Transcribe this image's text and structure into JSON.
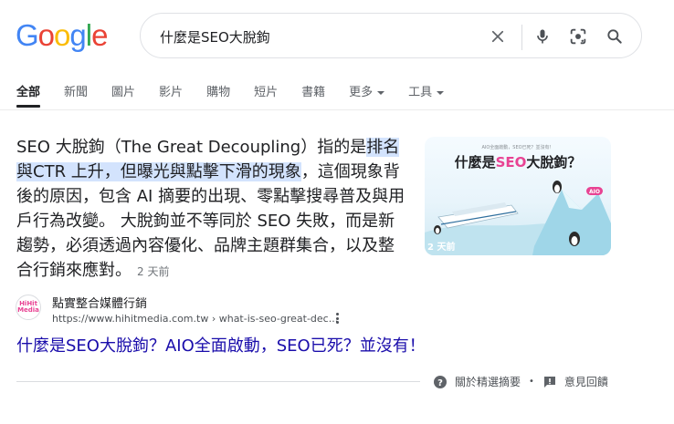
{
  "logo": {
    "letters": [
      "G",
      "o",
      "o",
      "g",
      "l",
      "e"
    ],
    "colors": [
      "#4285F4",
      "#EA4335",
      "#FBBC05",
      "#4285F4",
      "#34A853",
      "#EA4335"
    ]
  },
  "search": {
    "query": "什麼是SEO大脫鉤",
    "clear_icon": "close-icon",
    "voice_icon": "microphone-icon",
    "lens_icon": "camera-lens-icon",
    "search_icon": "search-icon"
  },
  "tabs": [
    {
      "label": "全部",
      "active": true
    },
    {
      "label": "新聞"
    },
    {
      "label": "圖片"
    },
    {
      "label": "影片"
    },
    {
      "label": "購物"
    },
    {
      "label": "短片"
    },
    {
      "label": "書籍"
    },
    {
      "label": "更多",
      "dropdown": true
    },
    {
      "label": "工具",
      "dropdown": true
    }
  ],
  "snippet": {
    "text_before": "SEO 大脫鉤（The Great Decoupling）指的是",
    "highlighted": "排名與CTR 上升，但曝光與點擊下滑的現象",
    "text_after": "，這個現象背後的原因，包含 AI 摘要的出現、零點擊搜尋普及與用戶行為改變。 大脫鉤並不等同於 SEO 失敗，而是新趨勢，必須透過內容優化、品牌主題群集合，以及整合行銷來應對。",
    "date": "2 天前"
  },
  "thumbnail": {
    "subtitle": "AIO全面啟動，SEO已死？並沒有！",
    "title_part1": "什麼是",
    "title_seo": "SEO",
    "title_part2": "大脫鉤？",
    "tag": "AIO",
    "badge": "2 天前",
    "accent": "#e84393"
  },
  "source": {
    "favicon_text": "HiHit Media",
    "name": "點實整合媒體行銷",
    "url": "https://www.hihitmedia.com.tw › what-is-seo-great-dec...",
    "title": "什麼是SEO大脫鉤？AIO全面啟動，SEO已死？並沒有！"
  },
  "footer": {
    "about_label": "關於精選摘要",
    "feedback_label": "意見回饋"
  }
}
